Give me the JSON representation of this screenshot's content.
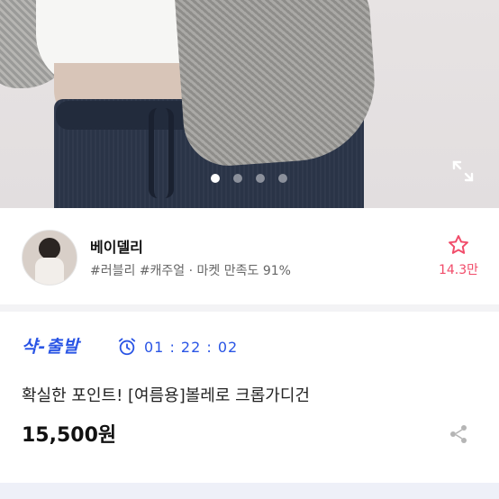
{
  "hero": {
    "slide_count": 4,
    "active_slide_index": 0,
    "expand_icon": "expand-icon"
  },
  "seller": {
    "name": "베이델리",
    "tags": "#러블리 #캐주얼 · 마켓 만족도 91%",
    "favorite_icon": "star-outline-icon",
    "favorite_count": "14.3만"
  },
  "product": {
    "badge": "샥-출발",
    "timer_icon": "alarm-clock-icon",
    "timer": "01 : 22 : 02",
    "title": "확실한 포인트! [여름용]볼레로 크롭가디건",
    "price": "15,500원",
    "share_icon": "share-icon"
  },
  "colors": {
    "accent_blue": "#2a55e5",
    "favorite_pink": "#f14b69"
  }
}
